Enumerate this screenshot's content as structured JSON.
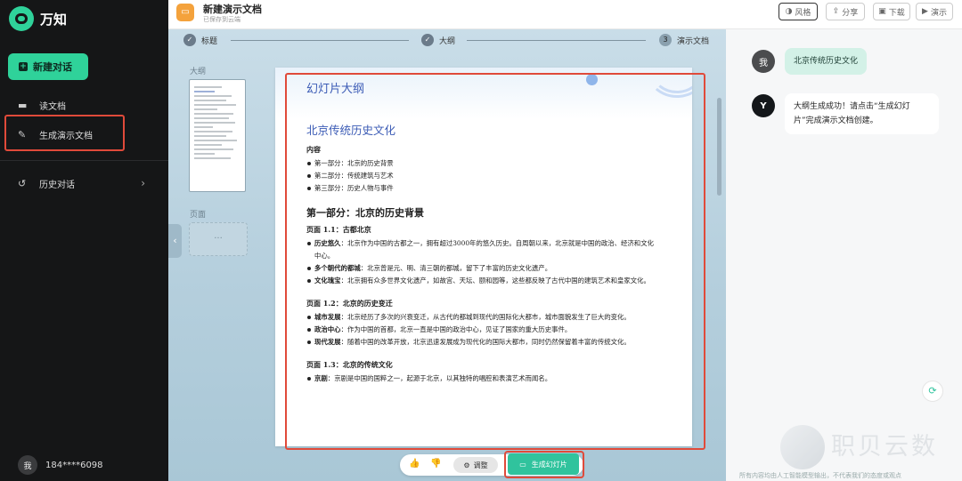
{
  "sidebar": {
    "brand": "万知",
    "new_chat": "新建对话",
    "items": [
      {
        "label": "读文档",
        "icon": "folder-icon"
      },
      {
        "label": "生成演示文档",
        "icon": "edit-icon"
      },
      {
        "label": "历史对话",
        "icon": "history-icon"
      }
    ],
    "user": {
      "avatar": "我",
      "name": "184****6098"
    }
  },
  "topbar": {
    "title": "新建演示文档",
    "subtitle": "已保存到云端",
    "buttons": [
      {
        "label": "风格",
        "icon": "palette-icon"
      },
      {
        "label": "分享",
        "icon": "share-icon"
      },
      {
        "label": "下载",
        "icon": "download-icon"
      },
      {
        "label": "演示",
        "icon": "play-icon"
      }
    ]
  },
  "steps": [
    {
      "label": "标题",
      "mark": "✓"
    },
    {
      "label": "大纲",
      "mark": "✓"
    },
    {
      "label": "演示文档",
      "mark": "3"
    }
  ],
  "panel": {
    "outline_label": "大纲",
    "page_label": "页面",
    "page_placeholder": "···"
  },
  "doc": {
    "header": "幻灯片大纲",
    "title": "北京传统历史文化",
    "contents_heading": "内容",
    "contents": [
      "第一部分：北京的历史背景",
      "第二部分：传统建筑与艺术",
      "第三部分：历史人物与事件"
    ],
    "part1_heading": "第一部分：北京的历史背景",
    "pages": [
      {
        "heading": "页面 1.1：古都北京",
        "items": [
          {
            "term": "历史悠久",
            "text": "：北京作为中国的古都之一，拥有超过3000年的悠久历史。自周朝以来，北京就是中国的政治、经济和文化中心。"
          },
          {
            "term": "多个朝代的都城",
            "text": "：北京曾是元、明、清三朝的都城，留下了丰富的历史文化遗产。"
          },
          {
            "term": "文化瑰宝",
            "text": "：北京拥有众多世界文化遗产，如故宫、天坛、颐和园等，这些都反映了古代中国的建筑艺术和皇家文化。"
          }
        ]
      },
      {
        "heading": "页面 1.2：北京的历史变迁",
        "items": [
          {
            "term": "城市发展",
            "text": "：北京经历了多次的兴衰变迁，从古代的都城到现代的国际化大都市，城市面貌发生了巨大的变化。"
          },
          {
            "term": "政治中心",
            "text": "：作为中国的首都，北京一直是中国的政治中心，见证了国家的重大历史事件。"
          },
          {
            "term": "现代发展",
            "text": "：随着中国的改革开放，北京迅速发展成为现代化的国际大都市，同时仍然保留着丰富的传统文化。"
          }
        ]
      },
      {
        "heading": "页面 1.3：北京的传统文化",
        "items": [
          {
            "term": "京剧",
            "text": "：京剧是中国的国粹之一，起源于北京，以其独特的唱腔和表演艺术而闻名。"
          }
        ]
      }
    ]
  },
  "bottom": {
    "adjust": "调整",
    "generate": "生成幻灯片"
  },
  "chat": {
    "user_avatar": "我",
    "user_message": "北京传统历史文化",
    "bot_avatar": "Y",
    "bot_message": "大纲生成成功！请点击“生成幻灯片”完成演示文档创建。",
    "footer": "所有内容均由人工智能模型输出，不代表我们的态度或观点"
  },
  "watermark": "职贝云数",
  "colors": {
    "accent": "#2fd29a",
    "highlight": "#e04a3a"
  }
}
